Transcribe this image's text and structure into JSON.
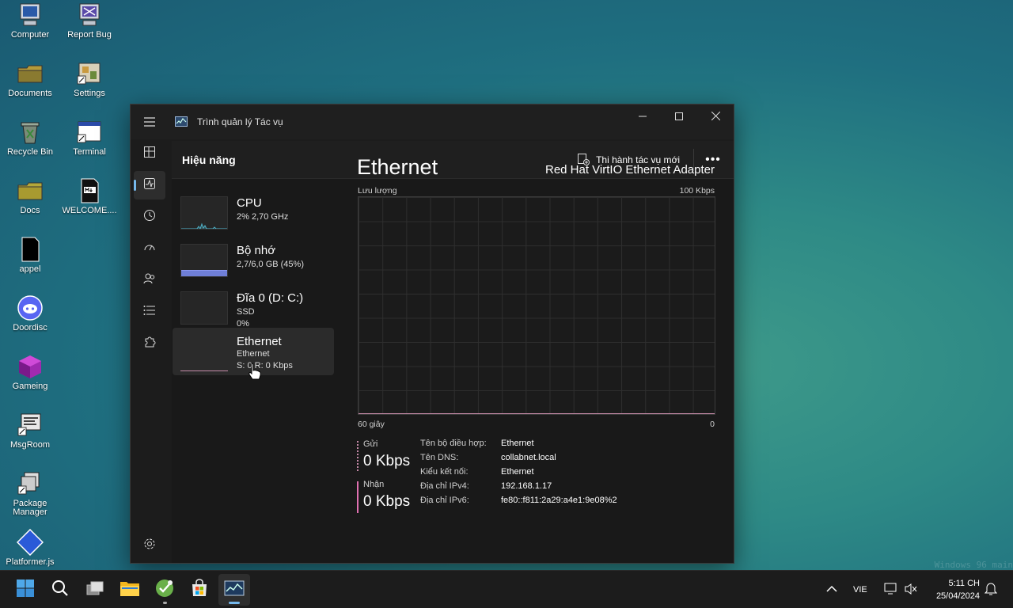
{
  "desktop": {
    "icons": [
      {
        "label": "Computer"
      },
      {
        "label": "Report Bug"
      },
      {
        "label": "Documents"
      },
      {
        "label": "Settings"
      },
      {
        "label": "Recycle Bin"
      },
      {
        "label": "Terminal"
      },
      {
        "label": "Docs"
      },
      {
        "label": "WELCOME...."
      },
      {
        "label": "appel"
      },
      {
        "label": "Doordisc"
      },
      {
        "label": "Gameing"
      },
      {
        "label": "MsgRoom"
      },
      {
        "label": "Package Manager"
      },
      {
        "label": "Platformer.js"
      }
    ],
    "watermark": "Windows 96 main"
  },
  "window": {
    "title": "Trình quản lý Tác vụ",
    "controls": {
      "minimize": "—",
      "maximize": "☐",
      "close": "✕"
    }
  },
  "header": {
    "page_title": "Hiệu năng",
    "run_task": "Thi hành tác vụ mới",
    "more": "•••"
  },
  "perf_items": [
    {
      "name": "CPU",
      "line1": "2% 2,70 GHz",
      "line2": ""
    },
    {
      "name": "Bộ nhớ",
      "line1": "2,7/6,0 GB (45%)",
      "line2": ""
    },
    {
      "name": "Đĩa 0 (D: C:)",
      "line1": "SSD",
      "line2": "0%"
    },
    {
      "name": "Ethernet",
      "line1": "Ethernet",
      "line2": "S: 0  R: 0 Kbps"
    }
  ],
  "memory_usage_percent": 45,
  "detail": {
    "title": "Ethernet",
    "adapter": "Red Hat VirtIO Ethernet Adapter",
    "graph_label": "Lưu lượng",
    "graph_max": "100 Kbps",
    "graph_time": "60 giây",
    "graph_min": "0",
    "send_label": "Gửi",
    "send_value": "0 Kbps",
    "recv_label": "Nhận",
    "recv_value": "0 Kbps",
    "properties": [
      {
        "key": "Tên bộ điều hợp:",
        "value": "Ethernet"
      },
      {
        "key": "Tên DNS:",
        "value": "collabnet.local"
      },
      {
        "key": "Kiểu kết nối:",
        "value": "Ethernet"
      },
      {
        "key": "Địa chỉ IPv4:",
        "value": "192.168.1.17"
      },
      {
        "key": "Địa chỉ IPv6:",
        "value": "fe80::f811:2a29:a4e1:9e08%2"
      }
    ]
  },
  "taskbar": {
    "language": "VIE",
    "time": "5:11 CH",
    "date": "25/04/2024"
  },
  "colors": {
    "accent": "#76b9ed",
    "send_bar": "#c58aa8",
    "recv_bar": "#e070b0",
    "memory_fill": "#6f7fd8",
    "cpu_line": "#4fb3c9"
  }
}
